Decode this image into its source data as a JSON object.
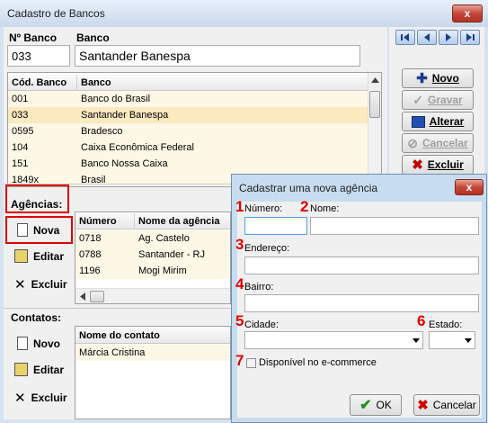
{
  "window": {
    "title": "Cadastro de Bancos",
    "close_glyph": "x"
  },
  "bank_form": {
    "numero_label": "Nº Banco",
    "banco_label": "Banco",
    "numero_value": "033",
    "banco_value": "Santander Banespa"
  },
  "banks_grid": {
    "columns": [
      "Cód. Banco",
      "Banco"
    ],
    "rows": [
      [
        "001",
        "Banco do Brasil"
      ],
      [
        "033",
        "Santander Banespa"
      ],
      [
        "0595",
        "Bradesco"
      ],
      [
        "104",
        "Caixa Econômica Federal"
      ],
      [
        "151",
        "Banco Nossa Caixa"
      ],
      [
        "1849x",
        "Brasil"
      ]
    ],
    "selected_row": 1
  },
  "actions": {
    "novo": "Novo",
    "gravar": "Gravar",
    "alterar": "Alterar",
    "cancelar": "Cancelar",
    "excluir": "Excluir"
  },
  "agencias": {
    "section_label": "Agências:",
    "buttons": {
      "nova": "Nova",
      "editar": "Editar",
      "excluir": "Excluir"
    },
    "columns": [
      "Número",
      "Nome da agência"
    ],
    "rows": [
      [
        "0718",
        "Ag. Castelo"
      ],
      [
        "0788",
        "Santander - RJ"
      ],
      [
        "1196",
        "Mogi Mirim"
      ]
    ]
  },
  "contatos": {
    "section_label": "Contatos:",
    "buttons": {
      "novo": "Novo",
      "editar": "Editar",
      "excluir": "Excluir"
    },
    "columns": [
      "Nome do contato"
    ],
    "rows": [
      [
        "Márcia Cristina"
      ]
    ]
  },
  "dialog": {
    "title": "Cadastrar uma nova agência",
    "close_glyph": "x",
    "markers": [
      "1",
      "2",
      "3",
      "4",
      "5",
      "6",
      "7"
    ],
    "fields": {
      "numero_label": "Número:",
      "nome_label": "Nome:",
      "endereco_label": "Endereço:",
      "bairro_label": "Bairro:",
      "cidade_label": "Cidade:",
      "estado_label": "Estado:",
      "ecommerce_label": "Disponível no e-commerce"
    },
    "ok_label": "OK",
    "cancel_label": "Cancelar"
  },
  "colors": {
    "highlight_red": "#e00000",
    "selected_row": "#fbe9c0",
    "grid_row": "#fdf8e6"
  }
}
